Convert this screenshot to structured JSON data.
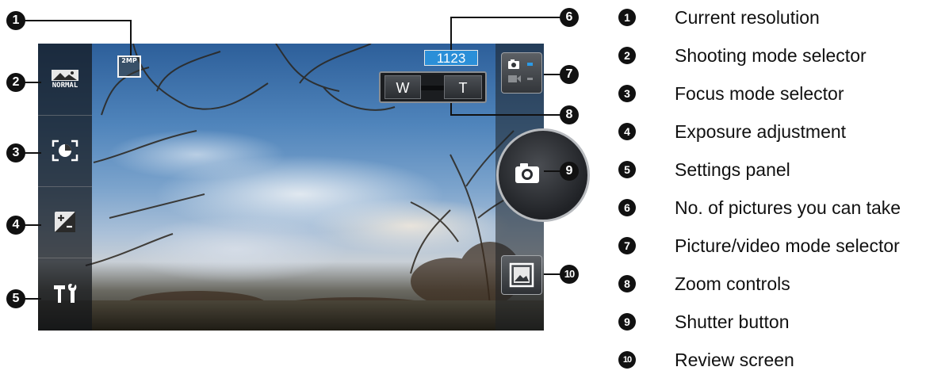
{
  "screen": {
    "resolution_badge": "2MP",
    "shooting_mode_label": "NORMAL",
    "picture_count": "1123",
    "zoom_wide": "W",
    "zoom_tele": "T"
  },
  "callouts": [
    "1",
    "2",
    "3",
    "4",
    "5",
    "6",
    "7",
    "8",
    "9",
    "10"
  ],
  "legend": [
    {
      "num": "1",
      "text": "Current resolution"
    },
    {
      "num": "2",
      "text": "Shooting mode selector"
    },
    {
      "num": "3",
      "text": "Focus mode selector"
    },
    {
      "num": "4",
      "text": "Exposure adjustment"
    },
    {
      "num": "5",
      "text": "Settings panel"
    },
    {
      "num": "6",
      "text": "No. of pictures you can take"
    },
    {
      "num": "7",
      "text": "Picture/video mode selector"
    },
    {
      "num": "8",
      "text": "Zoom controls"
    },
    {
      "num": "9",
      "text": "Shutter button"
    },
    {
      "num": "10",
      "text": "Review screen"
    }
  ],
  "icons": [
    "landscape-icon",
    "focus-icon",
    "exposure-icon",
    "tools-icon",
    "camera-icon",
    "video-icon",
    "gallery-icon"
  ],
  "colors": {
    "count_badge": "#2b8fd8",
    "marker": "#111111"
  }
}
